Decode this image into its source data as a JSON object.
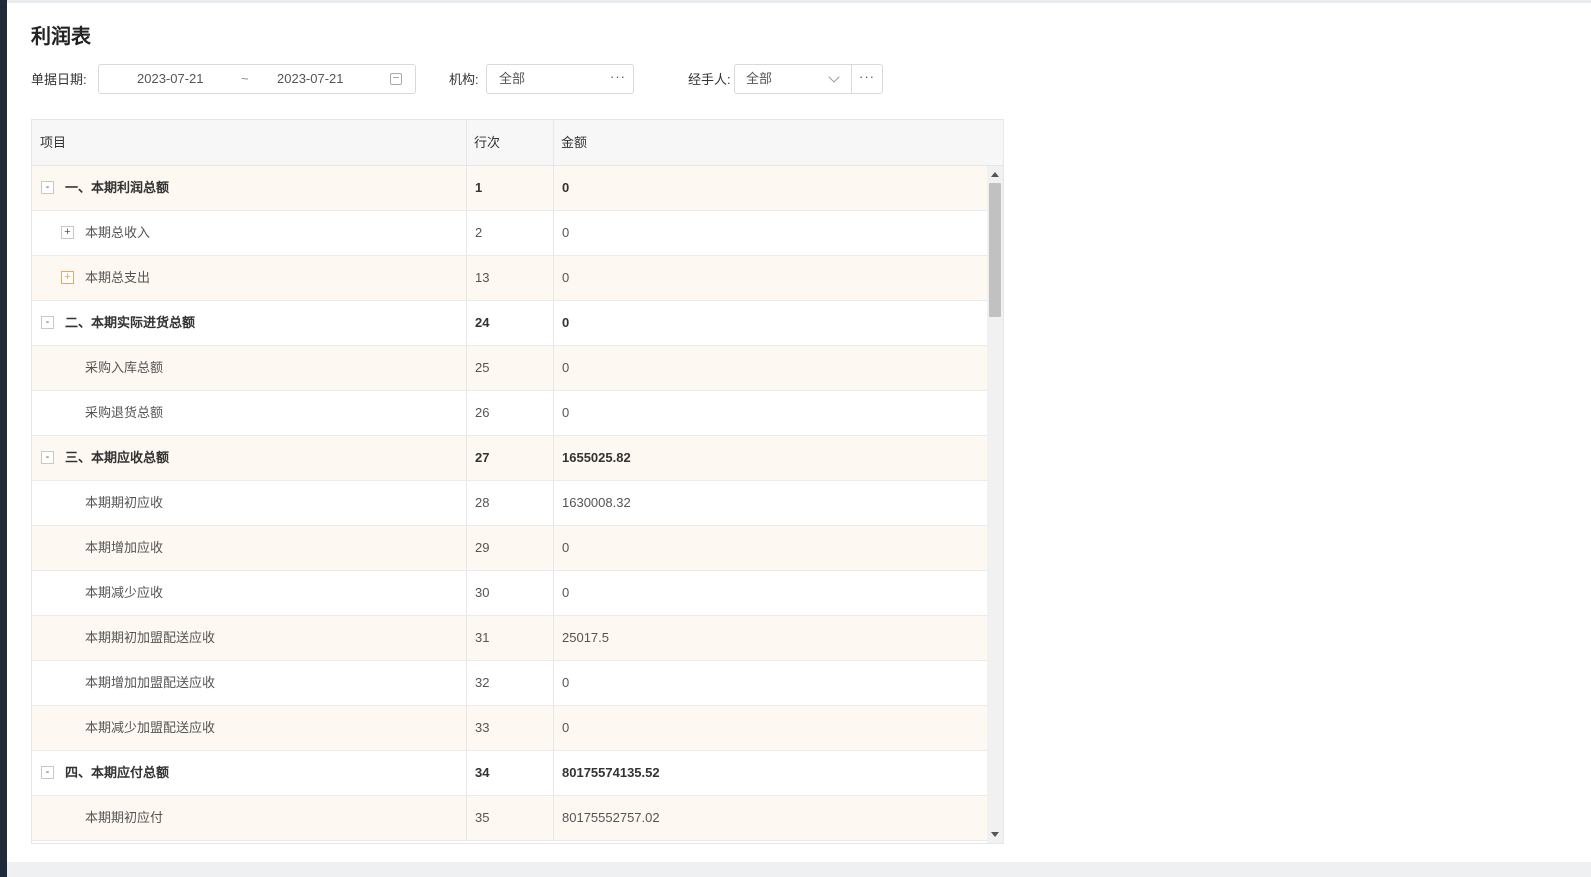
{
  "page_title": "利润表",
  "filters": {
    "date_label": "单据日期:",
    "date_start": "2023-07-21",
    "date_separator": "~",
    "date_end": "2023-07-21",
    "org_label": "机构:",
    "org_value": "全部",
    "org_more": "···",
    "handler_label": "经手人:",
    "handler_value": "全部",
    "handler_more": "···"
  },
  "table": {
    "headers": {
      "item": "项目",
      "row_no": "行次",
      "amount": "金额"
    },
    "rows": [
      {
        "label": "一、本期利润总额",
        "row_no": "1",
        "amount": "0",
        "bold": true,
        "toggle": "-",
        "level": 0
      },
      {
        "label": "本期总收入",
        "row_no": "2",
        "amount": "0",
        "bold": false,
        "toggle": "+",
        "level": 1
      },
      {
        "label": "本期总支出",
        "row_no": "13",
        "amount": "0",
        "bold": false,
        "toggle": "+",
        "toggle_style": "orange",
        "level": 1
      },
      {
        "label": "二、本期实际进货总额",
        "row_no": "24",
        "amount": "0",
        "bold": true,
        "toggle": "-",
        "level": 0
      },
      {
        "label": "采购入库总额",
        "row_no": "25",
        "amount": "0",
        "bold": false,
        "level": 1
      },
      {
        "label": "采购退货总额",
        "row_no": "26",
        "amount": "0",
        "bold": false,
        "level": 1
      },
      {
        "label": "三、本期应收总额",
        "row_no": "27",
        "amount": "1655025.82",
        "bold": true,
        "toggle": "-",
        "level": 0
      },
      {
        "label": "本期期初应收",
        "row_no": "28",
        "amount": "1630008.32",
        "bold": false,
        "level": 1
      },
      {
        "label": "本期增加应收",
        "row_no": "29",
        "amount": "0",
        "bold": false,
        "level": 1
      },
      {
        "label": "本期减少应收",
        "row_no": "30",
        "amount": "0",
        "bold": false,
        "level": 1
      },
      {
        "label": "本期期初加盟配送应收",
        "row_no": "31",
        "amount": "25017.5",
        "bold": false,
        "level": 1
      },
      {
        "label": "本期增加加盟配送应收",
        "row_no": "32",
        "amount": "0",
        "bold": false,
        "level": 1
      },
      {
        "label": "本期减少加盟配送应收",
        "row_no": "33",
        "amount": "0",
        "bold": false,
        "level": 1
      },
      {
        "label": "四、本期应付总额",
        "row_no": "34",
        "amount": "80175574135.52",
        "bold": true,
        "toggle": "-",
        "level": 0
      },
      {
        "label": "本期期初应付",
        "row_no": "35",
        "amount": "80175552757.02",
        "bold": false,
        "level": 1
      }
    ]
  },
  "icons": {
    "calendar": "calendar-icon",
    "chevron": "chevron-down-icon",
    "scroll_up": "arrow-up-icon",
    "scroll_down": "arrow-down-icon"
  },
  "colors": {
    "row_alt_bg": "#fdf8f2",
    "header_bg": "#f7f7f7",
    "toggle_accent": "#f0a35e"
  }
}
